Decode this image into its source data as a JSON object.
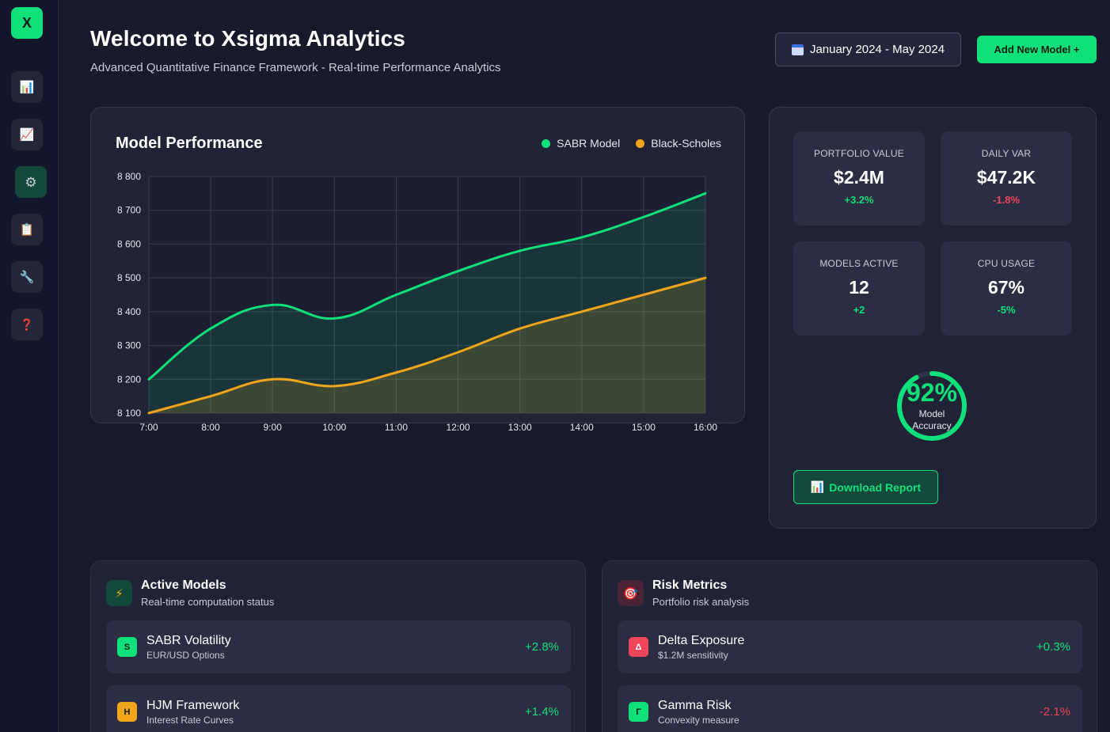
{
  "sidebar": {
    "logo": "X",
    "items": [
      {
        "name": "dashboard",
        "icon": "bar-chart-icon",
        "glyph": "📊"
      },
      {
        "name": "analytics",
        "icon": "line-chart-icon",
        "glyph": "📈"
      },
      {
        "name": "settings",
        "icon": "gear-icon",
        "glyph": "⚙"
      },
      {
        "name": "reports",
        "icon": "clipboard-icon",
        "glyph": "📋"
      },
      {
        "name": "tools",
        "icon": "wrench-icon",
        "glyph": "🔧"
      },
      {
        "name": "help",
        "icon": "question-icon",
        "glyph": "❓"
      }
    ]
  },
  "header": {
    "title": "Welcome to Xsigma Analytics",
    "subtitle": "Advanced Quantitative Finance Framework - Real-time Performance Analytics",
    "date_range": "January 2024 - May 2024",
    "add_model_label": "Add New Model +"
  },
  "colors": {
    "accent": "#10e07a",
    "sabr": "#10e07a",
    "black_scholes": "#f0a51a",
    "negative": "#f0455a"
  },
  "chart_data": {
    "type": "line",
    "title": "Model Performance",
    "x": [
      "7:00",
      "8:00",
      "9:00",
      "10:00",
      "11:00",
      "12:00",
      "13:00",
      "14:00",
      "15:00",
      "16:00"
    ],
    "series": [
      {
        "name": "SABR Model",
        "values": [
          8200,
          8350,
          8420,
          8380,
          8450,
          8520,
          8580,
          8620,
          8680,
          8750
        ]
      },
      {
        "name": "Black-Scholes",
        "values": [
          8100,
          8150,
          8200,
          8180,
          8220,
          8280,
          8350,
          8400,
          8450,
          8500
        ]
      }
    ],
    "ylim": [
      8100,
      8800
    ],
    "yticks": [
      "8 800",
      "8 700",
      "8 600",
      "8 500",
      "8 400",
      "8 300",
      "8 200",
      "8 100"
    ],
    "grid": true,
    "legend": "top-right"
  },
  "stats": [
    {
      "label": "Portfolio Value",
      "value": "$2.4M",
      "change": "+3.2%",
      "direction": "pos"
    },
    {
      "label": "Daily VaR",
      "value": "$47.2K",
      "change": "-1.8%",
      "direction": "neg"
    },
    {
      "label": "Models Active",
      "value": "12",
      "change": "+2",
      "direction": "pos"
    },
    {
      "label": "CPU Usage",
      "value": "67%",
      "change": "-5%",
      "direction": "pos"
    }
  ],
  "accuracy": {
    "percent": "92%",
    "fraction": 0.92,
    "label_line1": "Model",
    "label_line2": "Accuracy"
  },
  "download_label": "Download Report",
  "active_models": {
    "title": "Active Models",
    "subtitle": "Real-time computation status",
    "icon": "lightning-icon",
    "rows": [
      {
        "badge": "S",
        "name": "SABR Volatility",
        "desc": "EUR/USD Options",
        "change": "+2.8%",
        "direction": "pos"
      },
      {
        "badge": "H",
        "name": "HJM Framework",
        "desc": "Interest Rate Curves",
        "change": "+1.4%",
        "direction": "pos"
      }
    ]
  },
  "risk_metrics": {
    "title": "Risk Metrics",
    "subtitle": "Portfolio risk analysis",
    "icon": "target-icon",
    "rows": [
      {
        "badge": "Δ",
        "name": "Delta Exposure",
        "desc": "$1.2M sensitivity",
        "change": "+0.3%",
        "direction": "pos"
      },
      {
        "badge": "Γ",
        "name": "Gamma Risk",
        "desc": "Convexity measure",
        "change": "-2.1%",
        "direction": "neg"
      }
    ]
  }
}
